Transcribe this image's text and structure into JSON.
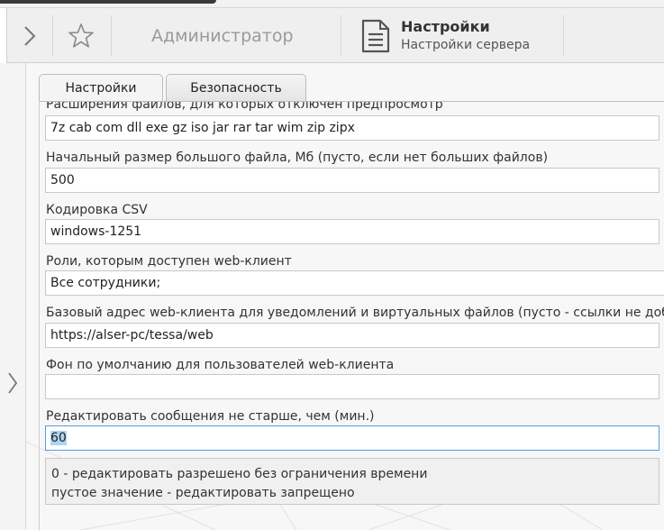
{
  "toolbar": {
    "user_label": "Администратор",
    "settings_title": "Настройки",
    "settings_subtitle": "Настройки сервера"
  },
  "tabs": [
    {
      "label": "Настройки",
      "active": true
    },
    {
      "label": "Безопасность",
      "active": false
    }
  ],
  "fields": [
    {
      "label": "Расширения файлов, для которых отключен предпросмотр",
      "value": "7z cab com dll exe gz iso jar rar tar wim zip zipx"
    },
    {
      "label": "Начальный размер большого файла, Мб (пусто, если нет больших файлов)",
      "value": "500"
    },
    {
      "label": "Кодировка CSV",
      "value": "windows-1251"
    },
    {
      "label": "Роли, которым доступен web-клиент",
      "value": "Все сотрудники;"
    },
    {
      "label": "Базовый адрес web-клиента для уведомлений и виртуальных файлов (пусто - ссылки не добавляю",
      "value": "https://alser-pc/tessa/web"
    },
    {
      "label": "Фон по умолчанию для пользователей web-клиента",
      "value": ""
    },
    {
      "label": "Редактировать сообщения не старше, чем (мин.)",
      "value": "60"
    }
  ],
  "hint": {
    "line1": "0 - редактировать разрешено без ограничения времени",
    "line2": "пустое значение - редактировать запрещено"
  },
  "icons": {
    "expand": "chevron-right-icon",
    "favorite": "star-icon",
    "settings": "document-icon",
    "side_expand": "chevron-right-icon"
  }
}
